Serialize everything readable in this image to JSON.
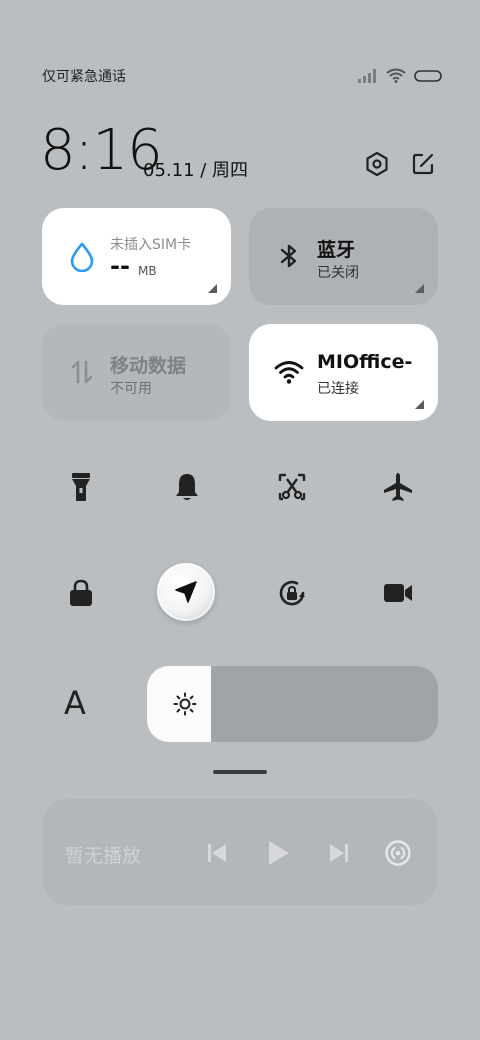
{
  "status_bar": {
    "carrier_text": "仅可紧急通话",
    "icons": [
      "signal-icon",
      "wifi-icon",
      "battery-icon"
    ]
  },
  "header": {
    "time": "8:16",
    "date": "05.11 / 周四",
    "icons": [
      "settings-icon",
      "edit-icon"
    ]
  },
  "tiles": {
    "data_usage": {
      "subtitle": "未插入SIM卡",
      "value": "--",
      "unit": "MB",
      "icon": "water-drop-icon",
      "accent": "#2b9af3"
    },
    "bluetooth": {
      "title": "蓝牙",
      "status": "已关闭",
      "icon": "bluetooth-icon"
    },
    "mobile_data": {
      "title": "移动数据",
      "status": "不可用",
      "icon": "mobile-data-icon"
    },
    "wifi": {
      "title": "MIOffice-",
      "status": "已连接",
      "icon": "wifi-icon"
    }
  },
  "toggles": {
    "row1": [
      "flashlight-icon",
      "bell-icon",
      "screenshot-icon",
      "airplane-icon"
    ],
    "row2": [
      "lock-icon",
      "location-icon",
      "rotation-lock-icon",
      "video-camera-icon"
    ]
  },
  "brightness": {
    "font_label": "A",
    "level": 0.22,
    "icon": "sun-icon"
  },
  "media": {
    "status_text": "暂无播放",
    "controls": [
      "previous-icon",
      "play-icon",
      "next-icon",
      "cast-icon"
    ]
  },
  "colors": {
    "background": "#bbbec1",
    "tile_active": "#ffffff",
    "tile_inactive": "#aeb1b5",
    "accent_blue": "#2b9af3"
  }
}
